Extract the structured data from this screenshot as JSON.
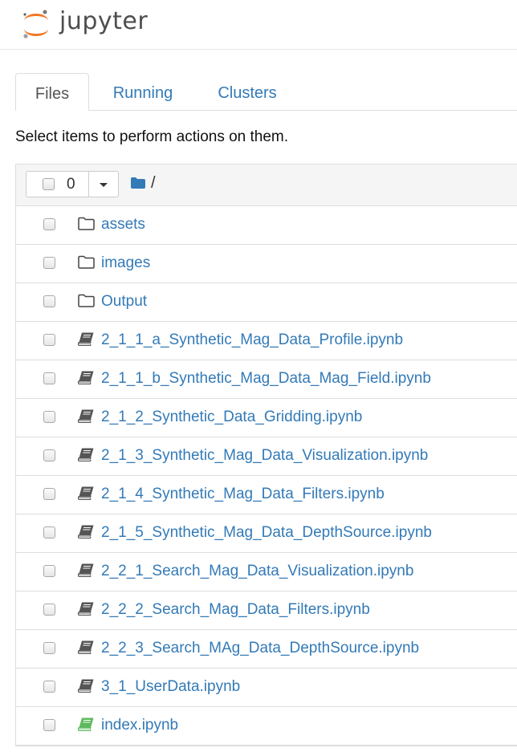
{
  "header": {
    "logo_text": "jupyter"
  },
  "tabs": [
    {
      "label": "Files",
      "active": true
    },
    {
      "label": "Running",
      "active": false
    },
    {
      "label": "Clusters",
      "active": false
    }
  ],
  "tip": "Select items to perform actions on them.",
  "toolbar": {
    "selected_count": "0",
    "path": "/"
  },
  "colors": {
    "link": "#337ab7",
    "notebook_icon": "#555555",
    "running_notebook_icon": "#5cb85c"
  },
  "items": [
    {
      "type": "folder",
      "icon": "folder-icon",
      "name": "assets"
    },
    {
      "type": "folder",
      "icon": "folder-icon",
      "name": "images"
    },
    {
      "type": "folder",
      "icon": "folder-icon",
      "name": "Output"
    },
    {
      "type": "notebook",
      "icon": "notebook-icon",
      "name": "2_1_1_a_Synthetic_Mag_Data_Profile.ipynb"
    },
    {
      "type": "notebook",
      "icon": "notebook-icon",
      "name": "2_1_1_b_Synthetic_Mag_Data_Mag_Field.ipynb"
    },
    {
      "type": "notebook",
      "icon": "notebook-icon",
      "name": "2_1_2_Synthetic_Data_Gridding.ipynb"
    },
    {
      "type": "notebook",
      "icon": "notebook-icon",
      "name": "2_1_3_Synthetic_Mag_Data_Visualization.ipynb"
    },
    {
      "type": "notebook",
      "icon": "notebook-icon",
      "name": "2_1_4_Synthetic_Mag_Data_Filters.ipynb"
    },
    {
      "type": "notebook",
      "icon": "notebook-icon",
      "name": "2_1_5_Synthetic_Mag_Data_DepthSource.ipynb"
    },
    {
      "type": "notebook",
      "icon": "notebook-icon",
      "name": "2_2_1_Search_Mag_Data_Visualization.ipynb"
    },
    {
      "type": "notebook",
      "icon": "notebook-icon",
      "name": "2_2_2_Search_Mag_Data_Filters.ipynb"
    },
    {
      "type": "notebook",
      "icon": "notebook-icon",
      "name": "2_2_3_Search_MAg_Data_DepthSource.ipynb"
    },
    {
      "type": "notebook",
      "icon": "notebook-icon",
      "name": "3_1_UserData.ipynb"
    },
    {
      "type": "notebook-running",
      "icon": "notebook-running-icon",
      "name": "index.ipynb"
    }
  ]
}
